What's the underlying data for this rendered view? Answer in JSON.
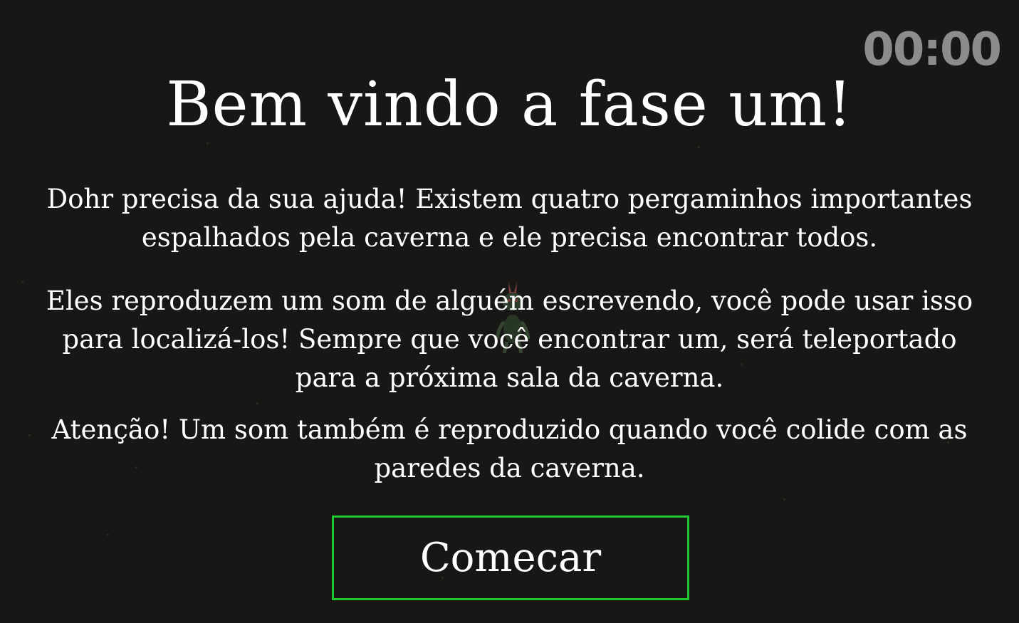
{
  "timer": "00:00",
  "title": "Bem vindo a fase um!",
  "paragraphs": [
    "Dohr precisa da sua ajuda! Existem quatro pergaminhos importantes espalhados pela caverna e ele precisa encontrar todos.",
    "Eles reproduzem um som de alguém escrevendo, você pode usar isso para localizá-los! Sempre que você encontrar um, será teleportado para a próxima sala da caverna.",
    "Atenção! Um som também é reproduzido quando você colide com as paredes da caverna."
  ],
  "start_button_label": "Comecar",
  "colors": {
    "background": "#181716",
    "button_border": "#1ec832",
    "timer": "#8c8c8c"
  }
}
